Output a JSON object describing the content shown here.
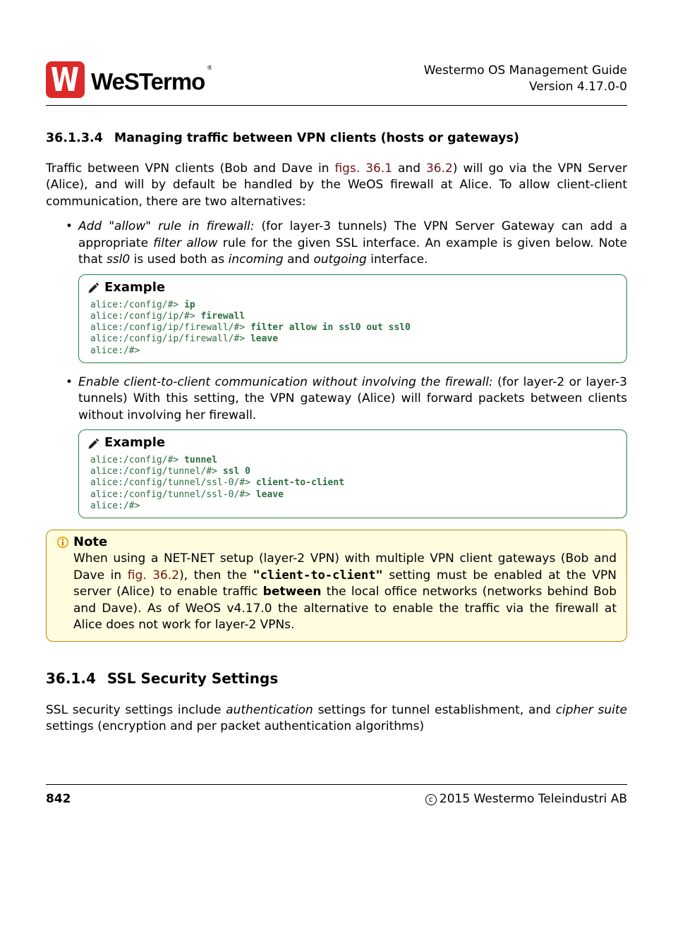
{
  "header": {
    "title": "Westermo OS Management Guide",
    "version": "Version 4.17.0-0"
  },
  "section1": {
    "num": "36.1.3.4",
    "title": "Managing traffic between VPN clients (hosts or gateways)"
  },
  "intro": {
    "pre_link": "Traffic between VPN clients (Bob and Dave in ",
    "link1": "figs. 36.1",
    "mid": " and ",
    "link2": "36.2",
    "post_link": ") will go via the VPN Server (Alice), and will by default be handled by the WeOS firewall at Alice. To allow client-client communication, there are two alternatives:"
  },
  "bullet1": {
    "lead": "Add \"allow\" rule in firewall:",
    "body1": " (for layer-3 tunnels) The VPN Server Gateway can add a appropriate ",
    "em1": "filter allow",
    "body2": " rule for the given SSL interface. An example is given below. Note that ",
    "em2": "ssl0",
    "body3": " is used both as ",
    "em3": "incoming",
    "body4": " and ",
    "em4": "outgoing",
    "body5": " interface."
  },
  "example_label": "Example",
  "example1": {
    "l1p": "alice:/config/#> ",
    "l1c": "ip",
    "l2p": "alice:/config/ip/#> ",
    "l2c": "firewall",
    "l3p": "alice:/config/ip/firewall/#> ",
    "l3c": "filter allow in ssl0 out ssl0",
    "l4p": "alice:/config/ip/firewall/#> ",
    "l4c": "leave",
    "l5p": "alice:/#>"
  },
  "bullet2": {
    "lead": "Enable client-to-client communication without involving the firewall:",
    "body": " (for layer-2 or layer-3 tunnels) With this setting, the VPN gateway (Alice) will forward packets between clients without involving her firewall."
  },
  "example2": {
    "l1p": "alice:/config/#> ",
    "l1c": "tunnel",
    "l2p": "alice:/config/tunnel/#> ",
    "l2c": "ssl 0",
    "l3p": "alice:/config/tunnel/ssl-0/#> ",
    "l3c": "client-to-client",
    "l4p": "alice:/config/tunnel/ssl-0/#> ",
    "l4c": "leave",
    "l5p": "alice:/#>"
  },
  "note": {
    "title": "Note",
    "body_a": "When using a NET-NET setup (layer-2 VPN) with multiple VPN client gateways (Bob and Dave in ",
    "link": "fig. 36.2",
    "body_b": "), then the ",
    "mono": "\"client-to-client\"",
    "body_c": " setting must be enabled at the VPN server (Alice) to enable traffic ",
    "bold": "between",
    "body_d": " the local office networks (networks behind Bob and Dave). As of WeOS v4.17.0 the alternative to enable the traffic via the firewall at Alice does not work for layer-2 VPNs."
  },
  "section2": {
    "num": "36.1.4",
    "title": "SSL Security Settings"
  },
  "para2": {
    "a": "SSL security settings include ",
    "em1": "authentication",
    "b": " settings for tunnel establishment, and ",
    "em2": "cipher suite",
    "c": " settings (encryption and per packet authentication algorithms)"
  },
  "footer": {
    "page": "842",
    "copyright": "2015 Westermo Teleindustri AB"
  }
}
